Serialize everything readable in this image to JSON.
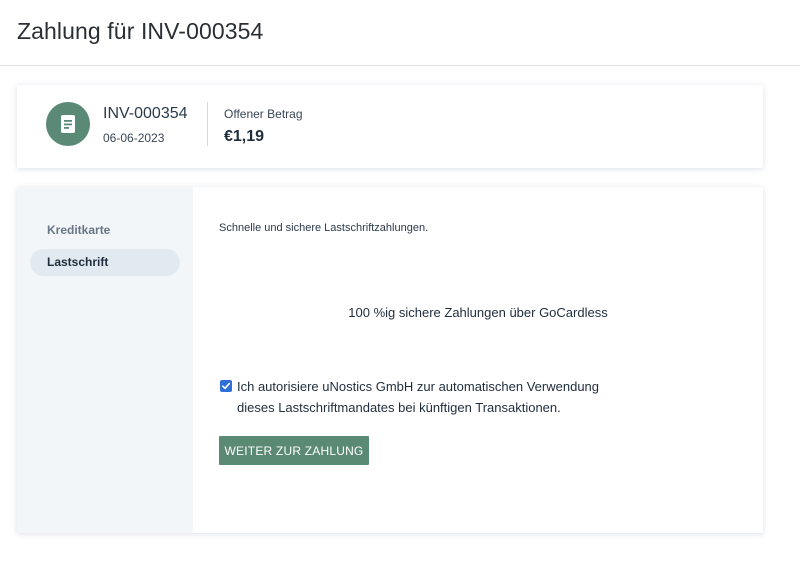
{
  "page": {
    "title": "Zahlung für INV-000354"
  },
  "invoice": {
    "number": "INV-000354",
    "date": "06-06-2023",
    "amount_label": "Offener Betrag",
    "amount_value": "€1,19",
    "icon": "invoice-document-icon",
    "avatar_color": "#5a8a76"
  },
  "payment_methods": [
    {
      "label": "Kreditkarte",
      "selected": false
    },
    {
      "label": "Lastschrift",
      "selected": true
    }
  ],
  "direct_debit": {
    "intro": "Schnelle und sichere Lastschriftzahlungen.",
    "secure_note": "100 %ig sichere Zahlungen über GoCardless",
    "consent_checked": true,
    "consent_lines": [
      "Ich autorisiere uNostics GmbH zur automatischen Verwendung",
      "dieses Lastschriftmandates bei künftigen Transaktionen."
    ],
    "continue_label": "WEITER ZUR ZAHLUNG"
  },
  "colors": {
    "accent": "#5b8a74",
    "checkbox": "#2f6fd8",
    "sidebar_bg": "#f3f6f9",
    "selected_item_bg": "#e2eaf1"
  }
}
